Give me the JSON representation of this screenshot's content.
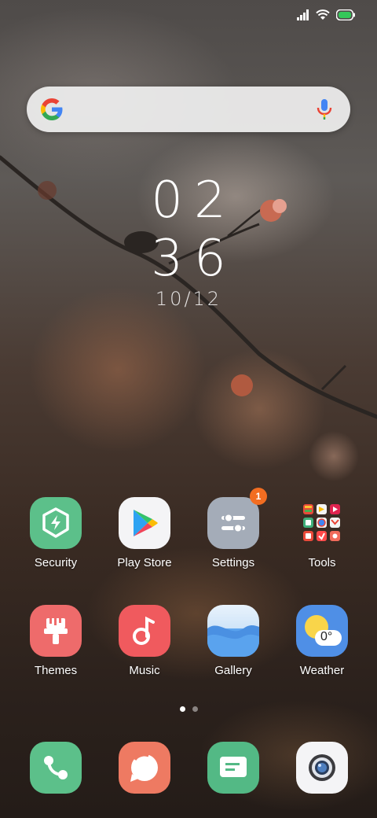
{
  "status_bar": {
    "signal_icon": "signal-icon",
    "wifi_icon": "wifi-icon",
    "battery_icon": "battery-icon",
    "battery_color": "#35c759"
  },
  "search": {
    "logo": "google-g-icon",
    "mic_icon": "mic-icon"
  },
  "clock": {
    "hours": "02",
    "minutes": "36",
    "date": "10/12"
  },
  "apps_row1": [
    {
      "label": "Security",
      "icon": "shield-bolt-icon",
      "color": "#5cc08a"
    },
    {
      "label": "Play Store",
      "icon": "play-store-icon",
      "color": "#f4f4f6"
    },
    {
      "label": "Settings",
      "icon": "sliders-icon",
      "color": "#a4acb8",
      "badge": "1"
    },
    {
      "label": "Tools",
      "icon": "folder-grid-icon",
      "color": "transparent"
    }
  ],
  "apps_row2": [
    {
      "label": "Themes",
      "icon": "paintbrush-icon",
      "color": "#ee6b6b"
    },
    {
      "label": "Music",
      "icon": "music-note-icon",
      "color": "#f05a5e"
    },
    {
      "label": "Gallery",
      "icon": "wave-icon",
      "color": "#5aa3ee"
    },
    {
      "label": "Weather",
      "icon": "sun-cloud-icon",
      "color": "#4f8fe6",
      "temp": "0°"
    }
  ],
  "page_indicator": {
    "active": 1,
    "total": 2
  },
  "dock": [
    {
      "icon": "phone-icon",
      "color": "#5cc08a"
    },
    {
      "icon": "chat-bubble-icon",
      "color": "#ee7a62"
    },
    {
      "icon": "message-icon",
      "color": "#53b985"
    },
    {
      "icon": "camera-icon",
      "color": "#f4f4f6"
    }
  ]
}
